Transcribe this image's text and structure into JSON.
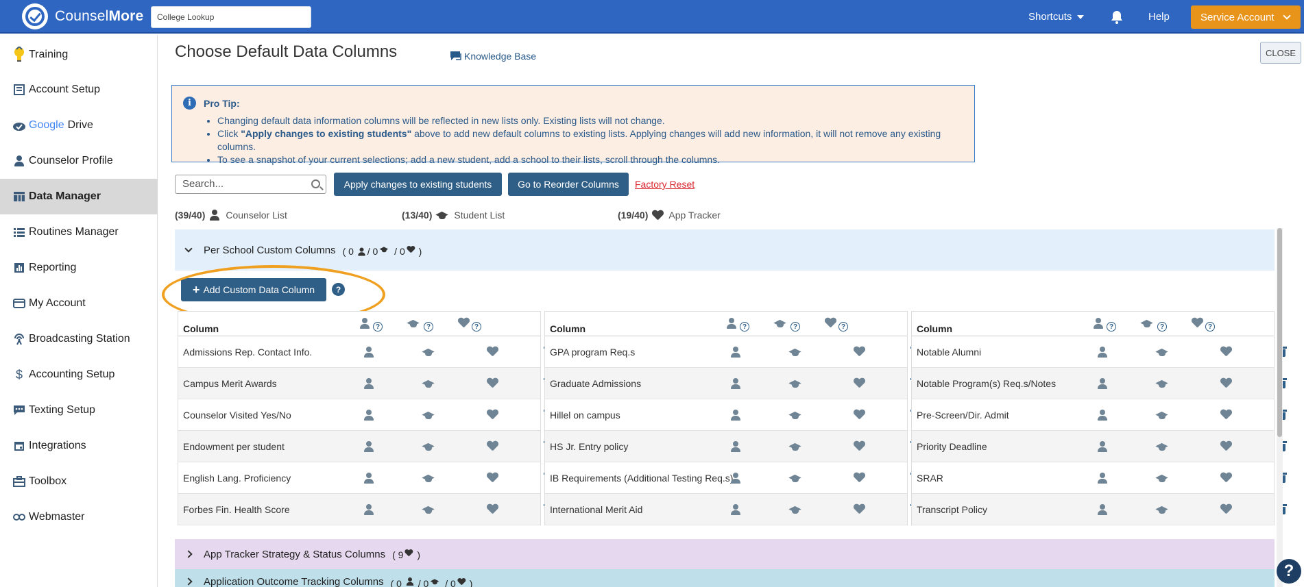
{
  "header": {
    "logo_counsel": "Counsel",
    "logo_more": "More",
    "lookup_value": "College Lookup",
    "shortcuts": "Shortcuts",
    "help": "Help",
    "service_account": "Service Account",
    "colors": {
      "bar": "#2f66c2",
      "service": "#e8941a"
    }
  },
  "sidebar": {
    "items": [
      {
        "label": "Training",
        "icon": "lightbulb-icon"
      },
      {
        "label": "Account Setup",
        "icon": "account-setup-icon"
      },
      {
        "label": "Drive",
        "icon": "google-drive-icon",
        "brand": "Google"
      },
      {
        "label": "Counselor Profile",
        "icon": "person-icon"
      },
      {
        "label": "Data Manager",
        "icon": "table-icon",
        "active": true
      },
      {
        "label": "Routines Manager",
        "icon": "list-icon"
      },
      {
        "label": "Reporting",
        "icon": "chart-icon"
      },
      {
        "label": "My Account",
        "icon": "card-icon"
      },
      {
        "label": "Broadcasting Station",
        "icon": "broadcast-icon"
      },
      {
        "label": "Accounting Setup",
        "icon": "dollar-icon"
      },
      {
        "label": "Texting Setup",
        "icon": "chat-icon"
      },
      {
        "label": "Integrations",
        "icon": "calendar-icon"
      },
      {
        "label": "Toolbox",
        "icon": "toolbox-icon"
      },
      {
        "label": "Webmaster",
        "icon": "link-icon"
      }
    ]
  },
  "main": {
    "title": "Choose Default Data Columns",
    "knowledge_base": "Knowledge Base",
    "close": "CLOSE",
    "protip": {
      "title": "Pro Tip:",
      "line1": "Changing default data information columns will be reflected in new lists only. Existing lists will not change.",
      "line2_pre": "Click ",
      "line2_bold": "\"Apply changes to existing students\"",
      "line2_post": " above to add new default columns to existing lists. Applying changes will add new information, it will not remove any existing columns.",
      "line3": "To see a snapshot of your current selections; add a new student, add a school to their lists, scroll through the columns."
    },
    "search_placeholder": "Search...",
    "apply_btn": "Apply changes to existing students",
    "reorder_btn": "Go to Reorder Columns",
    "factory_reset": "Factory Reset",
    "counts": [
      {
        "count": "(39/40)",
        "label": "Counselor List"
      },
      {
        "count": "(13/40)",
        "label": "Student List"
      },
      {
        "count": "(19/40)",
        "label": "App Tracker"
      }
    ],
    "section1": {
      "title": "Per School Custom Columns",
      "c1": "( 0",
      "c2": "/ 0",
      "c3": "/ 0",
      "c4": ")"
    },
    "add_btn": "Add Custom Data Column",
    "column_header": "Column",
    "tables": [
      [
        "Admissions Rep. Contact Info.",
        "Campus Merit Awards",
        "Counselor Visited Yes/No",
        "Endowment per student",
        "English Lang. Proficiency",
        "Forbes Fin. Health Score"
      ],
      [
        "GPA program Req.s",
        "Graduate Admissions",
        "Hillel on campus",
        "HS Jr. Entry policy",
        "IB Requirements (Additional Testing Req.s)",
        "International Merit Aid"
      ],
      [
        "Notable Alumni",
        "Notable Program(s) Req.s/Notes",
        "Pre-Screen/Dir. Admit",
        "Priority Deadline",
        "SRAR",
        "Transcript Policy"
      ]
    ],
    "section2": {
      "title": "App Tracker Strategy & Status Columns",
      "count_pre": "( 9",
      "count_post": ")"
    },
    "section3": {
      "title": "Application Outcome Tracking Columns",
      "c1": "( 0",
      "c2": "/ 0",
      "c3": "/ 0",
      "c4": ")"
    }
  }
}
